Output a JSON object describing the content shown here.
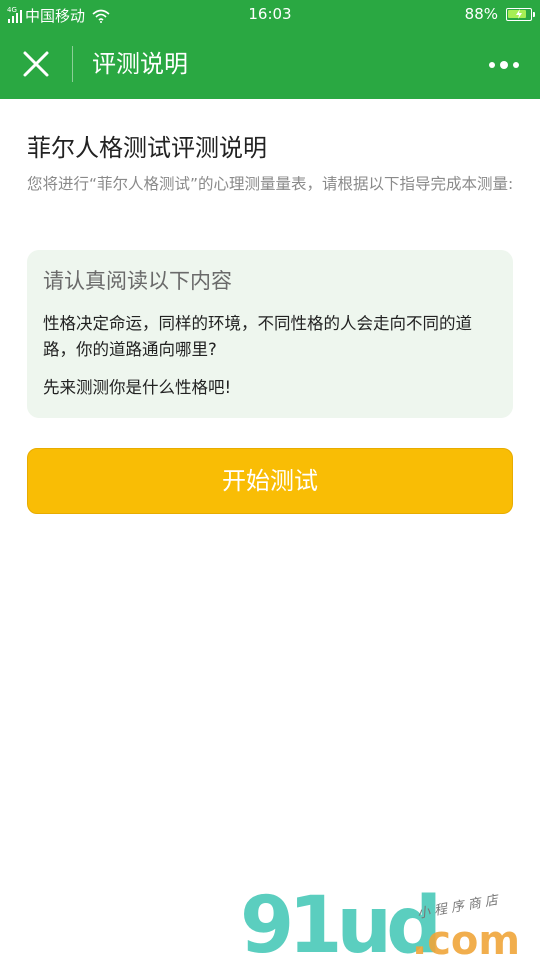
{
  "status_bar": {
    "network_type": "4G",
    "carrier": "中国移动",
    "time": "16:03",
    "battery_percent": "88%",
    "battery_level": 0.88,
    "battery_fill_color": "#a6ee54"
  },
  "navbar": {
    "title": "评测说明",
    "background_color": "#2aa842",
    "close_icon": "close-icon",
    "more_icon": "more-dots-icon"
  },
  "main": {
    "title": "菲尔人格测试评测说明",
    "intro": "您将进行“菲尔人格测试”的心理测量量表，请根据以下指导完成本测量:",
    "notice": {
      "title": "请认真阅读以下内容",
      "paragraph_1": "性格决定命运，同样的环境，不同性格的人会走向不同的道路，你的道路通向哪里?",
      "paragraph_2": "先来测测你是什么性格吧!"
    },
    "start_button": {
      "label": "开始测试",
      "color": "#f9bd05"
    }
  },
  "watermark": {
    "logo_text": "91ud",
    "domain_text": ".com",
    "tagline": "小程序商店"
  }
}
